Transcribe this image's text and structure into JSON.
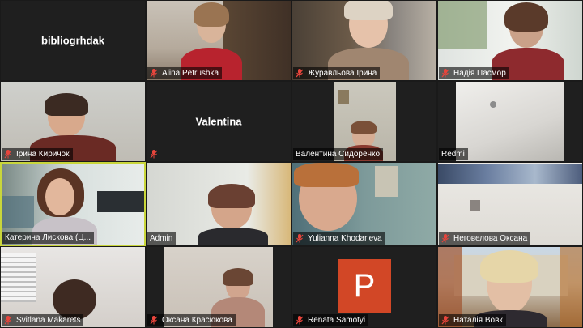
{
  "participants": [
    {
      "name": "bibliogrhdak",
      "label": "",
      "muted": false,
      "video": false
    },
    {
      "name": "Alina Petrushka",
      "label": "Alina Petrushka",
      "muted": true,
      "video": true
    },
    {
      "name": "Журавльова Ірина",
      "label": "Журавльова Ірина",
      "muted": true,
      "video": true
    },
    {
      "name": "Надія Пасмор",
      "label": "Надія Пасмор",
      "muted": true,
      "video": true
    },
    {
      "name": "Ірина Киричок",
      "label": "Ірина Киричок",
      "muted": true,
      "video": true
    },
    {
      "name": "Valentina",
      "label": "",
      "muted": true,
      "video": false
    },
    {
      "name": "Валентина Сидоренко",
      "label": "Валентина Сидоренко",
      "muted": false,
      "video": true
    },
    {
      "name": "Redmi",
      "label": "Redmi",
      "muted": false,
      "video": true
    },
    {
      "name": "Катерина Лискова (Ц...",
      "label": "Катерина Лискова (Ц...",
      "muted": false,
      "video": true,
      "active": true
    },
    {
      "name": "Admin",
      "label": "Admin",
      "muted": false,
      "video": true
    },
    {
      "name": "Yulianna Khodarieva",
      "label": "Yulianna Khodarieva",
      "muted": true,
      "video": true
    },
    {
      "name": "Неговелова Оксана",
      "label": "Неговелова Оксана",
      "muted": true,
      "video": true
    },
    {
      "name": "Svitlana Makarets",
      "label": "Svitlana Makarets",
      "muted": true,
      "video": true
    },
    {
      "name": "Оксана Красюкова",
      "label": "Оксана Красюкова",
      "muted": true,
      "video": true
    },
    {
      "name": "Renata Samotyi",
      "label": "Renata Samotyi",
      "muted": true,
      "video": false,
      "initial": "P"
    },
    {
      "name": "Наталія Вовк",
      "label": "Наталія Вовк",
      "muted": true,
      "video": true
    }
  ],
  "colors": {
    "active_border": "#c9d63b",
    "muted_icon": "#e8453c",
    "avatar_bg": "#d24726"
  }
}
